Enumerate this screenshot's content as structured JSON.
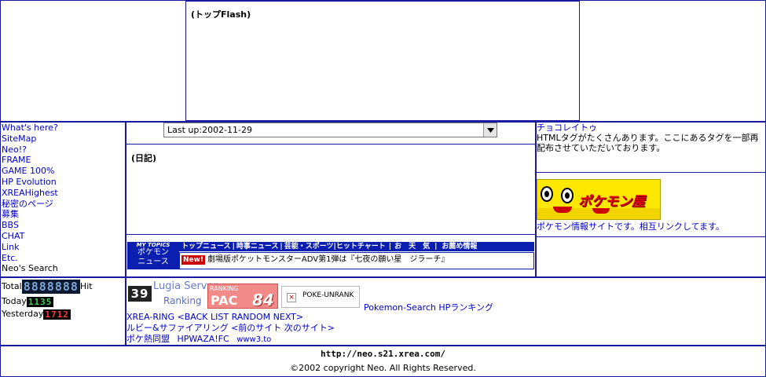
{
  "top": {
    "flash_label": "(トップFlash)"
  },
  "nav": {
    "items": [
      "What's here?",
      "SiteMap",
      "Neo!?",
      "FRAME",
      "GAME 100%",
      "HP Evolution",
      "XREAHighest",
      "秘密のページ",
      "募集",
      "BBS",
      "CHAT",
      "Link",
      "Etc.",
      "Neo's Search"
    ]
  },
  "center": {
    "select_value": "Last up:2002-11-29",
    "diary_label": "(日記)"
  },
  "news": {
    "badge_top": "MY TOPICS",
    "badge_line1": "ポケモン",
    "badge_line2": "ニュース",
    "tabs": [
      "トップニュース",
      "時事ニュース",
      "芸能・スポーツ",
      "ヒットチャート",
      "お　天　気",
      "お薦め情報"
    ],
    "new_badge": "New!",
    "headline": "劇場版ポケットモンスターADV第1弾は『七夜の願い星　ジラーチ』"
  },
  "right": {
    "title": "チョコレイトゥ",
    "desc": "HTMLタグがたくさんあります。ここにあるタグを一部再配布させていただいております。",
    "banner_text": "ポケモン屋",
    "banner_caption": "ポケモン情報サイトです。相互リンクしてます。"
  },
  "counter": {
    "total_label": "Total",
    "total_value": "8888888",
    "total_suffix": "Hit",
    "today_label": "Today",
    "today_value": "1135",
    "yesterday_label": "Yesterday",
    "yesterday_value": "1712"
  },
  "banners": {
    "lugia_number": "39",
    "lugia_line1": "Lugia Server",
    "lugia_line2": "Ranking",
    "pac_top": "RANKING",
    "pac_text": "PAC",
    "pac_number": "84",
    "poke_unrank": "POKE-UNRANK",
    "pokemon_search": "Pokemon-Search HPランキング"
  },
  "rings": {
    "xrea": "XREA-RING <BACK LIST RANDOM NEXT>",
    "ruby": "ルビー&サファイアリング <前のサイト 次のサイト>",
    "poke_prefix": "ポケ熱同盟",
    "hpwaza": "HPWAZA!FC",
    "www3": "www3.to"
  },
  "footer": {
    "url": "http://neo.s21.xrea.com/",
    "copyright": "©2002 copyright Neo. All Rights Reserved."
  },
  "colors": {
    "border": "#1a1aa0",
    "link": "#0000cc"
  }
}
